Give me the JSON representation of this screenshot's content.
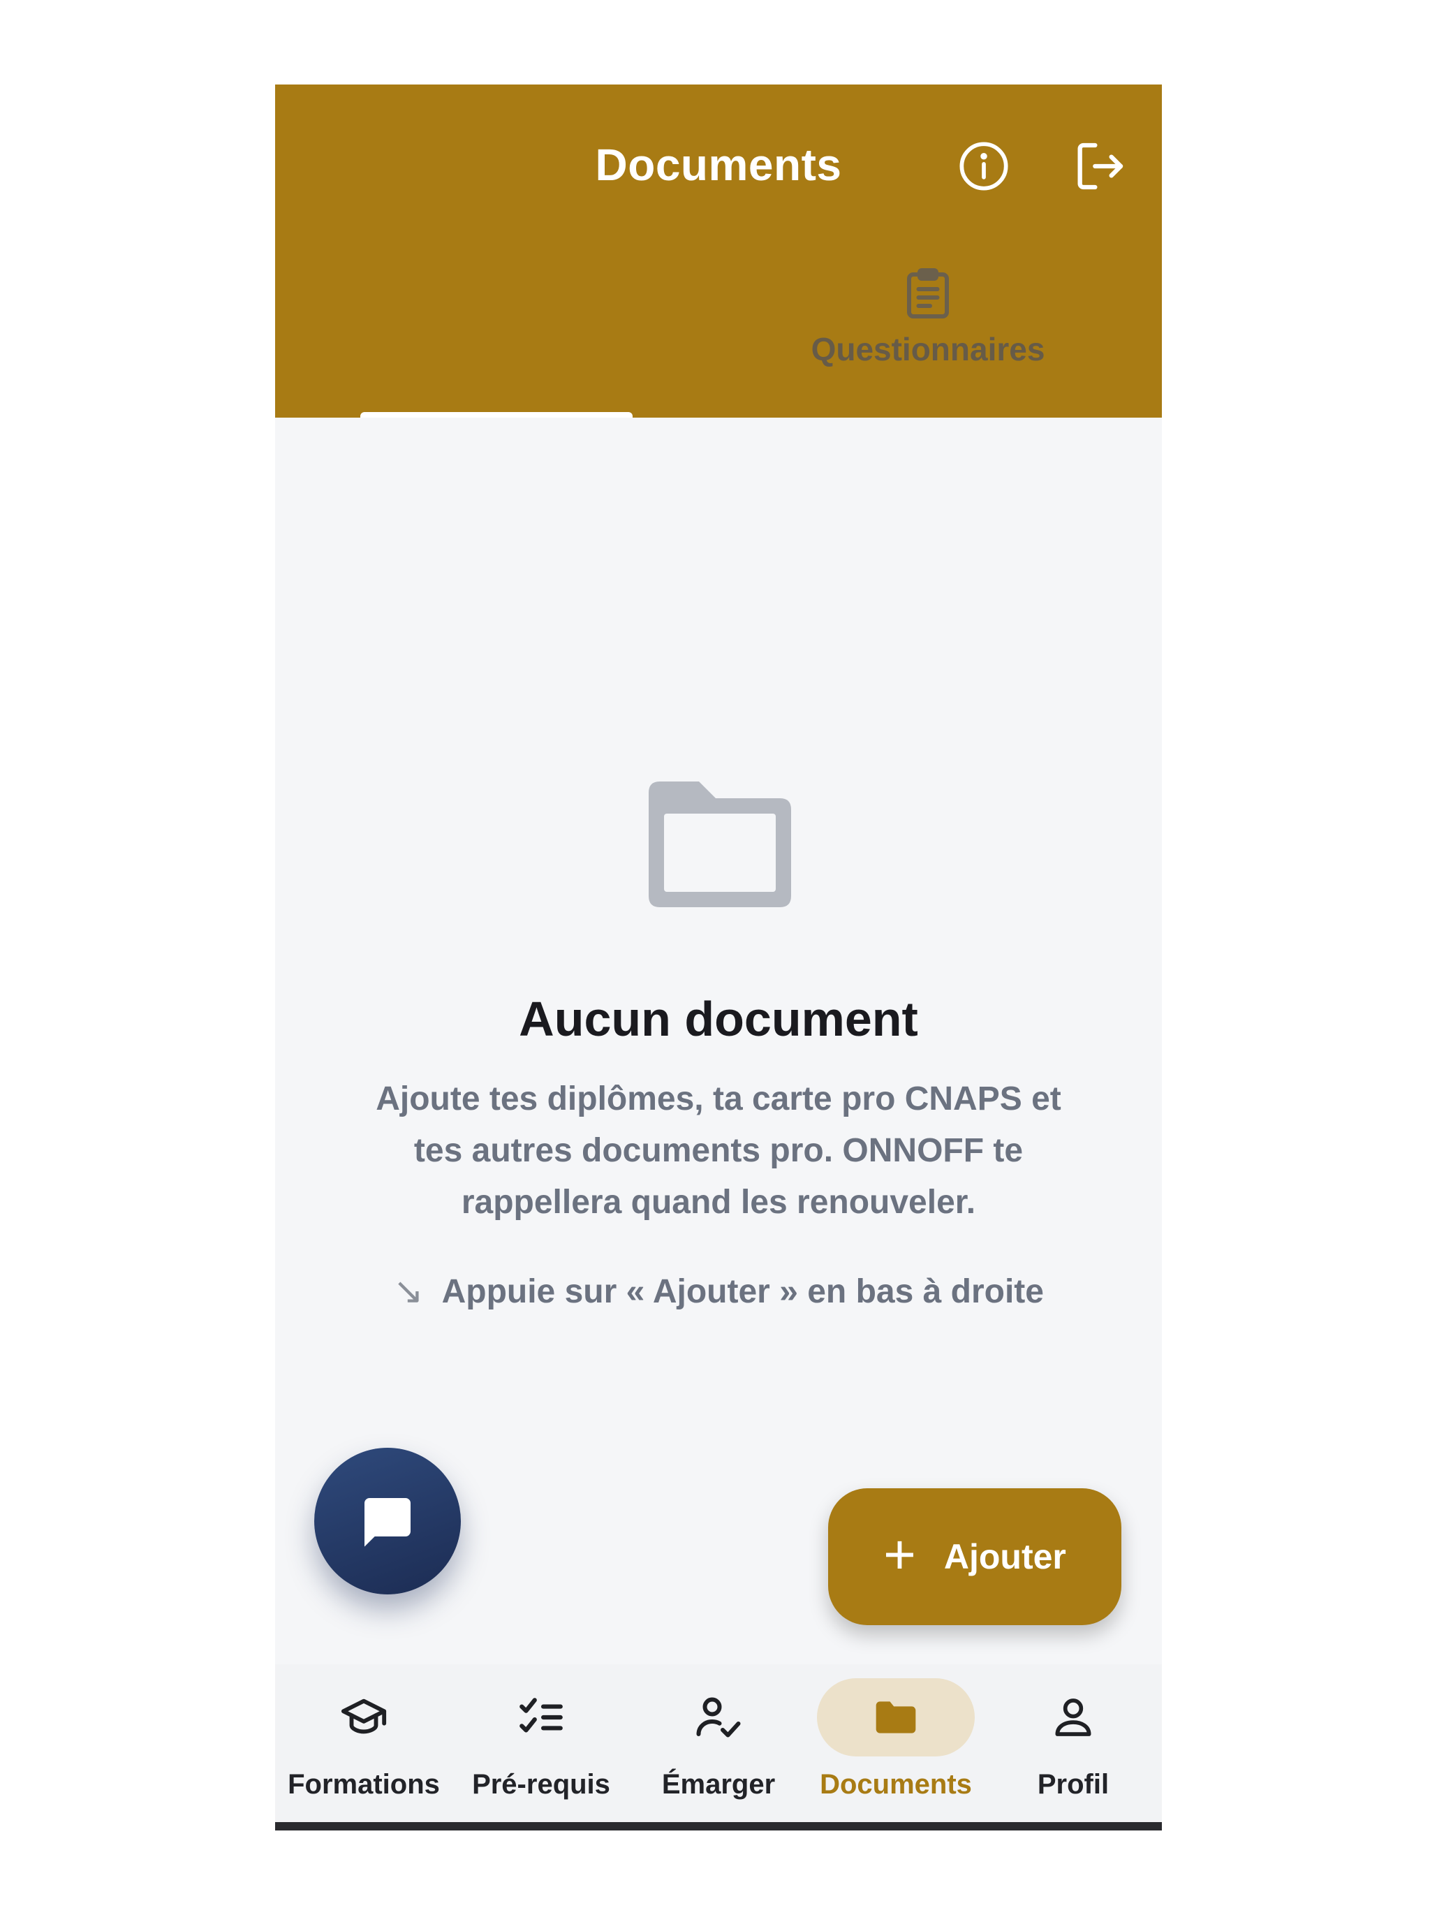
{
  "header": {
    "title": "Documents",
    "info_icon": "info-circle-icon",
    "logout_icon": "logout-icon"
  },
  "tabs": [
    {
      "label": "",
      "icon": "folder-icon",
      "active": true
    },
    {
      "label": "Questionnaires",
      "icon": "clipboard-icon",
      "active": false
    }
  ],
  "empty_state": {
    "icon": "folder-outline-icon",
    "title": "Aucun document",
    "description": "Ajoute tes diplômes, ta carte pro CNAPS et tes autres documents pro. ONNOFF te rappellera quand les renouveler.",
    "hint_arrow": "↘",
    "hint": "Appuie sur « Ajouter » en bas à droite"
  },
  "chat_fab": {
    "icon": "chat-bubble-icon"
  },
  "add_button": {
    "icon": "+",
    "label": "Ajouter"
  },
  "bottom_nav": {
    "items": [
      {
        "label": "Formations",
        "icon": "graduation-cap-icon",
        "active": false
      },
      {
        "label": "Pré-requis",
        "icon": "checklist-icon",
        "active": false
      },
      {
        "label": "Émarger",
        "icon": "user-check-icon",
        "active": false
      },
      {
        "label": "Documents",
        "icon": "folder-icon",
        "active": true
      },
      {
        "label": "Profil",
        "icon": "user-icon",
        "active": false
      }
    ]
  },
  "colors": {
    "brand": "#a87b14",
    "background": "#f5f6f8",
    "chat_fab": "#24396a",
    "active_pill": "#ece1ca",
    "muted_text": "#6b7280"
  }
}
